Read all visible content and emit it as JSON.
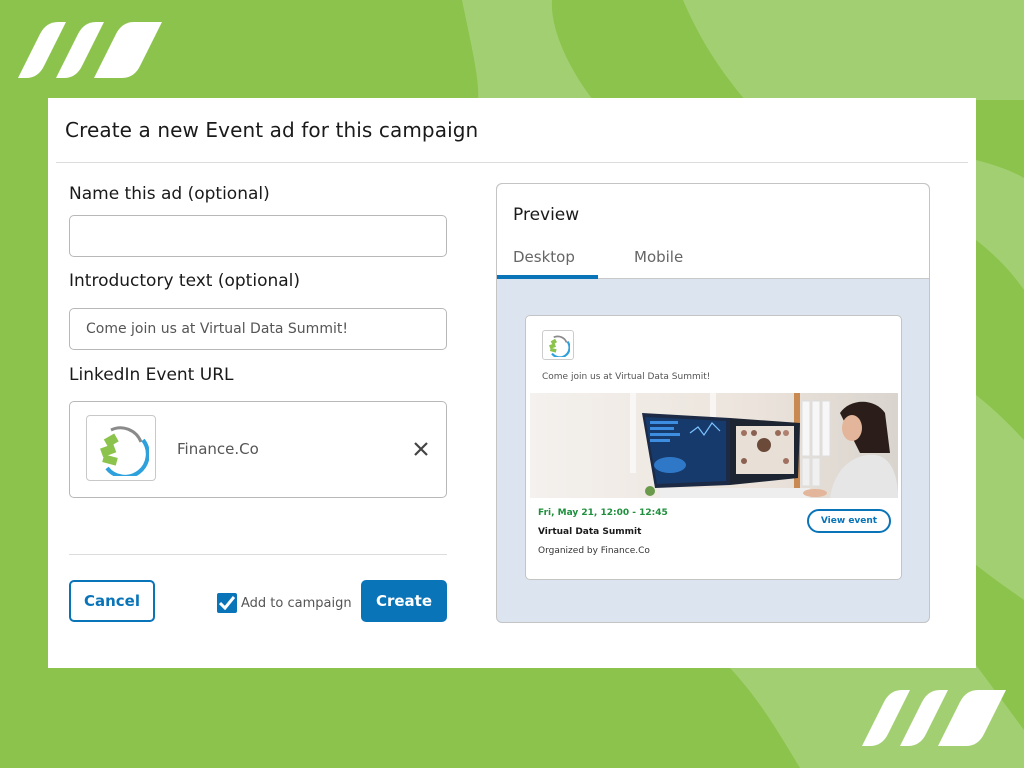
{
  "colors": {
    "background_green": "#8bc34d",
    "light_green": "#a2cf71",
    "primary_blue": "#0a74b9",
    "date_green": "#1e8f3c",
    "preview_bg": "#dce5ef"
  },
  "dialog": {
    "title": "Create a new Event ad for this campaign",
    "fields": {
      "name": {
        "label": "Name this ad (optional)",
        "value": "",
        "placeholder": ""
      },
      "intro": {
        "label": "Introductory text (optional)",
        "value": "Come join us at Virtual Data Summit!"
      },
      "event_url": {
        "label": "LinkedIn Event URL",
        "selected_event": "Finance.Co",
        "logo_icon": "finance-co-logo",
        "remove_icon": "close-icon"
      }
    },
    "footer": {
      "cancel_label": "Cancel",
      "checkbox_label": "Add to campaign",
      "checkbox_checked": true,
      "create_label": "Create"
    }
  },
  "preview": {
    "title": "Preview",
    "tabs": [
      {
        "label": "Desktop",
        "active": true
      },
      {
        "label": "Mobile",
        "active": false
      }
    ],
    "ad": {
      "intro_text": "Come join us at Virtual Data Summit!",
      "image_description": "Woman at desk viewing monitors with data dashboards and video call",
      "date": "Fri, May 21, 12:00 - 12:45",
      "event_title": "Virtual Data Summit",
      "organizer": "Organized by Finance.Co",
      "cta_label": "View event"
    }
  }
}
